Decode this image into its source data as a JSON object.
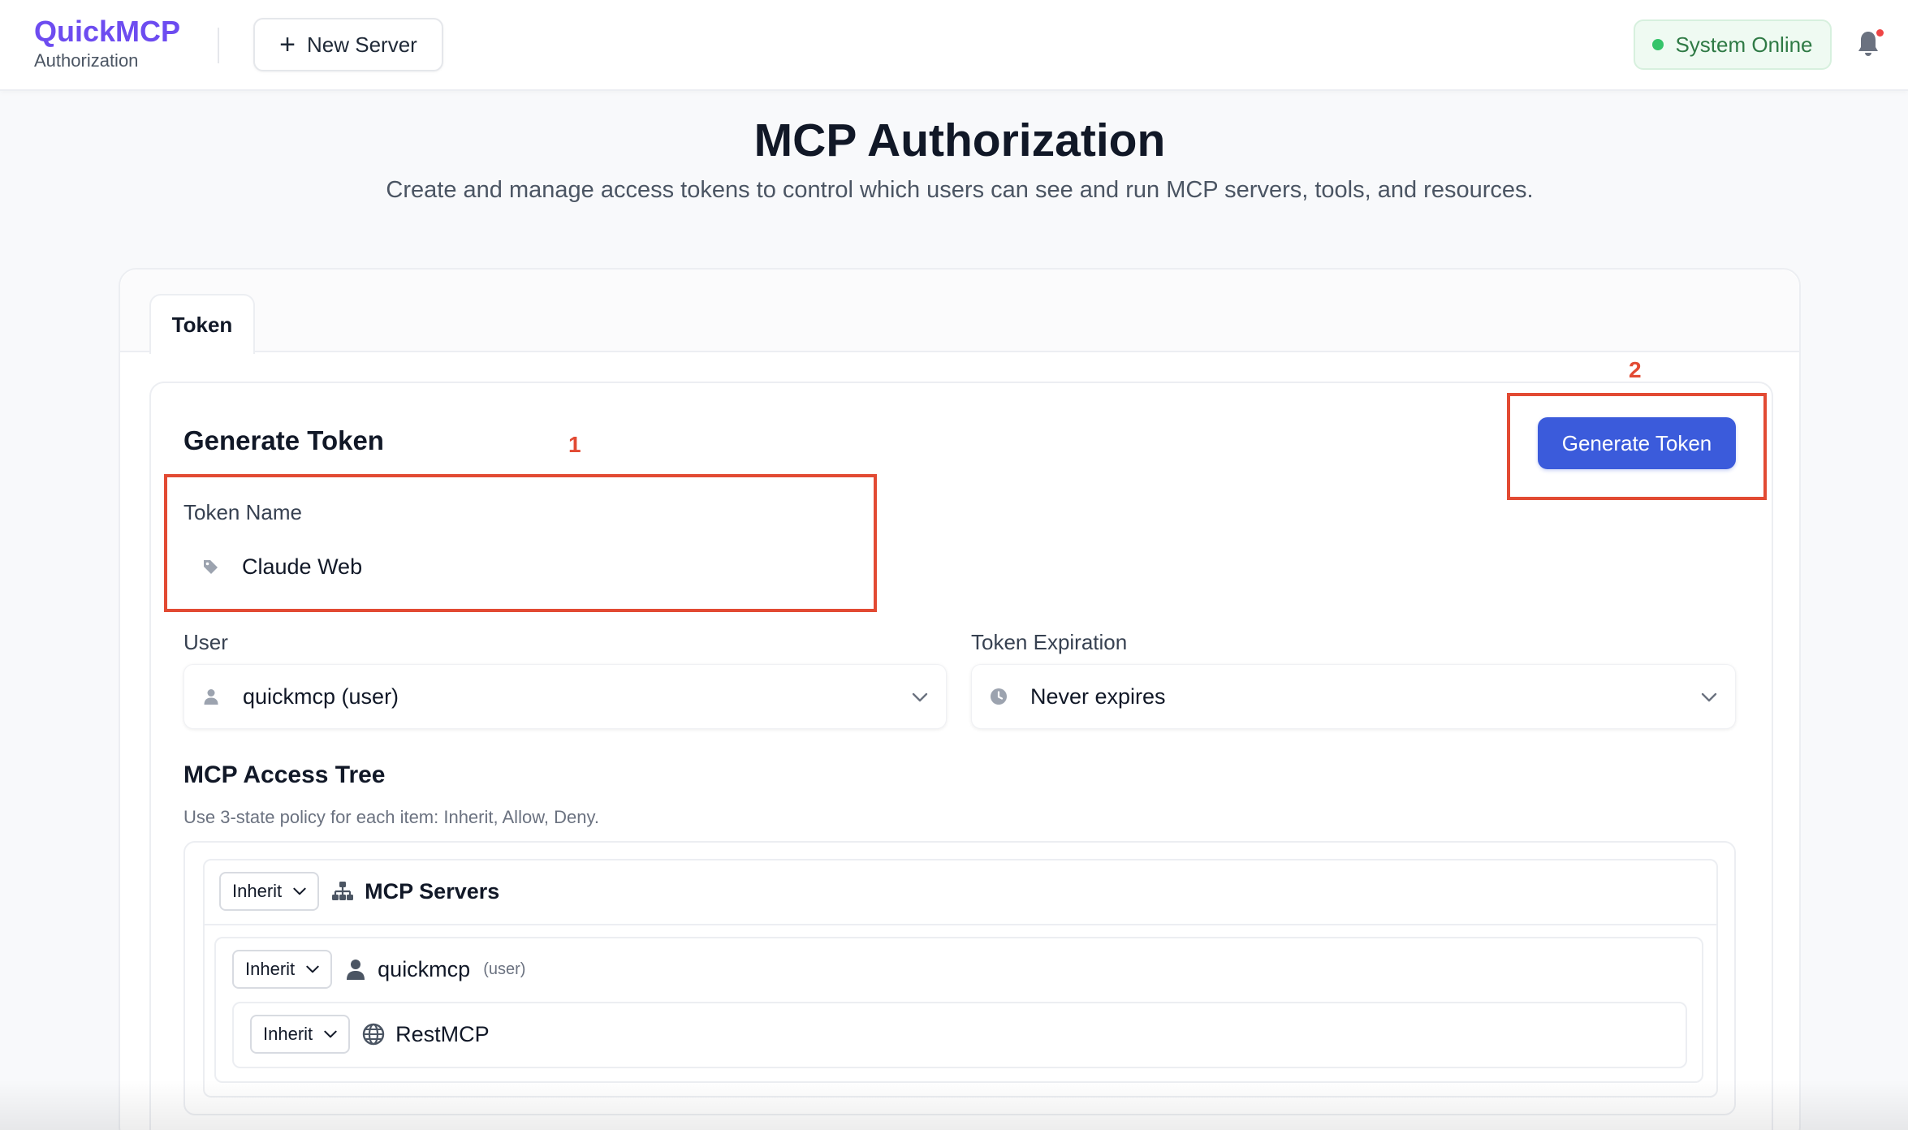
{
  "app": {
    "name": "QuickMCP",
    "section": "Authorization"
  },
  "header": {
    "new_server_label": "New Server",
    "status_label": "System Online",
    "status_color": "#35c46a"
  },
  "page": {
    "title": "MCP Authorization",
    "subtitle": "Create and manage access tokens to control which users can see and run MCP servers, tools, and resources."
  },
  "tabs": [
    {
      "label": "Token",
      "active": true
    }
  ],
  "generate": {
    "title": "Generate Token",
    "button_label": "Generate Token",
    "token_name": {
      "label": "Token Name",
      "value": "Claude Web",
      "icon": "tag-icon"
    },
    "user": {
      "label": "User",
      "value": "quickmcp (user)",
      "icon": "user-icon"
    },
    "expiration": {
      "label": "Token Expiration",
      "value": "Never expires",
      "icon": "clock-icon"
    }
  },
  "access_tree": {
    "title": "MCP Access Tree",
    "hint": "Use 3-state policy for each item: Inherit, Allow, Deny.",
    "root": {
      "policy": "Inherit",
      "label": "MCP Servers",
      "icon": "sitemap-icon",
      "children": [
        {
          "policy": "Inherit",
          "label": "quickmcp",
          "tag": "(user)",
          "icon": "user-icon",
          "children": [
            {
              "policy": "Inherit",
              "label": "RestMCP",
              "icon": "globe-icon"
            }
          ]
        }
      ]
    }
  },
  "annotations": [
    {
      "number": "1"
    },
    {
      "number": "2"
    }
  ],
  "colors": {
    "brand": "#6d4cf0",
    "primary": "#3b5bdb",
    "annotation": "#e24a33"
  }
}
